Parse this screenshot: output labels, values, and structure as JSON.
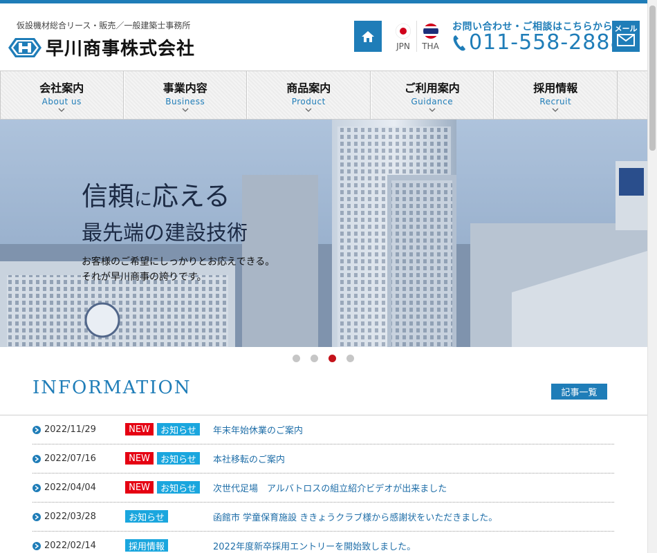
{
  "header": {
    "tagline": "仮設機材総合リース・販売／一般建築士事務所",
    "company_name": "早川商事株式会社",
    "lang": [
      {
        "code": "JPN"
      },
      {
        "code": "THA"
      }
    ],
    "contact_lead": "お問い合わせ・ご相談はこちらから",
    "tel": "011-558-2888",
    "mail_label": "メール"
  },
  "nav": [
    {
      "ja": "会社案内",
      "en": "About us"
    },
    {
      "ja": "事業内容",
      "en": "Business"
    },
    {
      "ja": "商品案内",
      "en": "Product"
    },
    {
      "ja": "ご利用案内",
      "en": "Guidance"
    },
    {
      "ja": "採用情報",
      "en": "Recruit"
    }
  ],
  "hero": {
    "line1_a": "信頼",
    "line1_b": "に",
    "line1_c": "応える",
    "line2": "最先端の建設技術",
    "sub1": "お客様のご希望にしっかりとお応えできる。",
    "sub2": "それが早川商事の誇りです。"
  },
  "carousel": {
    "count": 4,
    "active_index": 2
  },
  "info": {
    "title": "INFORMATION",
    "list_button": "記事一覧",
    "items": [
      {
        "date": "2022/11/29",
        "new": "NEW",
        "category": "お知らせ",
        "text": "年末年始休業のご案内"
      },
      {
        "date": "2022/07/16",
        "new": "NEW",
        "category": "お知らせ",
        "text": "本社移転のご案内"
      },
      {
        "date": "2022/04/04",
        "new": "NEW",
        "category": "お知らせ",
        "text": "次世代足場　アルバトロスの組立紹介ビデオが出来ました"
      },
      {
        "date": "2022/03/28",
        "new": "",
        "category": "お知らせ",
        "text": "函館市 学童保育施設 ききょうクラブ様から感謝状をいただきました。"
      },
      {
        "date": "2022/02/14",
        "new": "",
        "category": "採用情報",
        "text": "2022年度新卒採用エントリーを開始致しました。"
      }
    ]
  },
  "colors": {
    "brand_blue": "#1f7db8",
    "new_red": "#e50012",
    "category_cyan": "#1aa6de",
    "active_dot": "#c4121a"
  }
}
